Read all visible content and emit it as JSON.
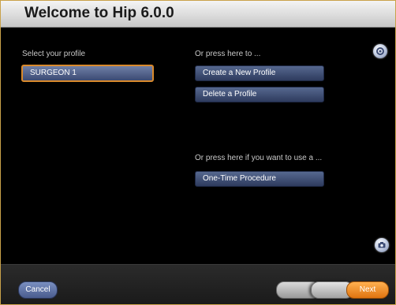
{
  "window": {
    "title": "Welcome to Hip 6.0.0"
  },
  "left": {
    "select_label": "Select your profile",
    "selected_profile": "SURGEON 1"
  },
  "right": {
    "press_label": "Or press here to ...",
    "create_button": "Create a New Profile",
    "delete_button": "Delete a Profile",
    "one_time_label": "Or press here if you want to use a ...",
    "one_time_button": "One-Time Procedure"
  },
  "icons": {
    "top_right": "settings-icon",
    "bottom_right": "camera-icon"
  },
  "footer": {
    "cancel_label": "Cancel",
    "next_label": "Next"
  },
  "colors": {
    "accent_orange": "#f08a1c",
    "button_blue": "#3b4a73"
  }
}
